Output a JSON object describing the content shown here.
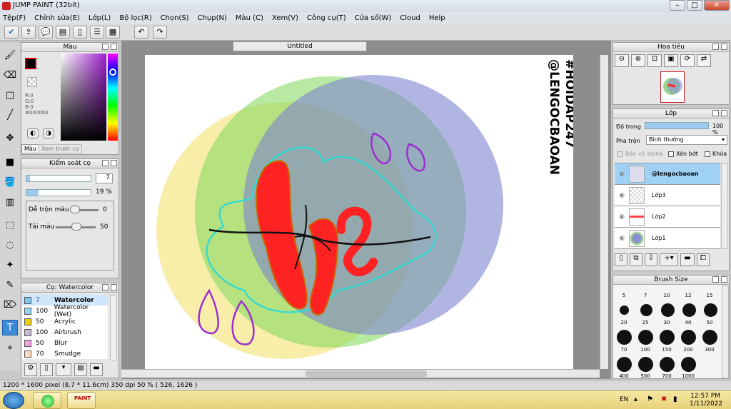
{
  "window": {
    "title": "JUMP PAINT (32bit)",
    "min": "–",
    "max": "□",
    "close": "✕"
  },
  "menu": [
    "Tệp(F)",
    "Chỉnh sửa(E)",
    "Lớp(L)",
    "Bộ lọc(R)",
    "Chọn(S)",
    "Chụp(N)",
    "Màu (C)",
    "Xem(V)",
    "Công cụ(T)",
    "Cửa sổ(W)",
    "Cloud",
    "Help"
  ],
  "canvas": {
    "tab_label": "Untitled",
    "watermark_line1": "@LENGOCBAOAN",
    "watermark_line2": "#HOIDAP247"
  },
  "color_panel": {
    "title": "Màu",
    "r": "R:0",
    "g": "G:0",
    "b": "B:0",
    "hex": "#000000",
    "tab_color": "Màu",
    "tab_preview": "Xem trước cọ",
    "fg": "#000000",
    "bg": "#ffffff"
  },
  "brush_control": {
    "title": "Kiểm soát cọ",
    "size_value": "7",
    "opacity_value": "19 %",
    "opacity_fraction": 0.19,
    "blend_label": "Dễ trộn màu",
    "blend_value": "0",
    "reload_label": "Tải màu",
    "reload_value": "50"
  },
  "brush_list": {
    "title": "Cọ: Watercolor",
    "items": [
      {
        "size": "7",
        "name": "Watercolor",
        "color": "#7ec8f0",
        "selected": true
      },
      {
        "size": "100",
        "name": "Watercolor (Wet)",
        "color": "#8fd3f5"
      },
      {
        "size": "50",
        "name": "Acrylic",
        "color": "#f0d000"
      },
      {
        "size": "100",
        "name": "Airbrush",
        "color": "#c8b8d8"
      },
      {
        "size": "50",
        "name": "Blur",
        "color": "#f0a0e0"
      },
      {
        "size": "70",
        "name": "Smudge",
        "color": "#f8d8c0"
      }
    ]
  },
  "navigator": {
    "title": "Hoa tiêu"
  },
  "layers": {
    "title": "Lớp",
    "opacity_label": "Độ trong",
    "opacity_value": "100 %",
    "blend_label": "Pha trộn",
    "blend_value": "Bình thường",
    "protect_alpha": "Bảo vệ alpha",
    "clipping": "Xén bớt",
    "lock": "Khóa",
    "items": [
      {
        "name": "@lengocbaoan",
        "selected": true
      },
      {
        "name": "Lớp3"
      },
      {
        "name": "Lớp2"
      },
      {
        "name": "Lớp1"
      }
    ]
  },
  "brush_size": {
    "title": "Brush Size",
    "top_labels": [
      "5",
      "7",
      "10",
      "12",
      "15"
    ],
    "rows": [
      [
        "20",
        "25",
        "30",
        "40",
        "50"
      ],
      [
        "70",
        "100",
        "150",
        "200",
        "300"
      ],
      [
        "400",
        "500",
        "700",
        "1000"
      ]
    ]
  },
  "status": {
    "text": "1200 * 1600 pixel  (8.7 * 11.6cm)  350 dpi  50 %  ( 526, 1626 )"
  },
  "taskbar": {
    "lang": "EN",
    "time": "12:57 PM",
    "date": "1/11/2022",
    "app_label": "PAINT"
  }
}
